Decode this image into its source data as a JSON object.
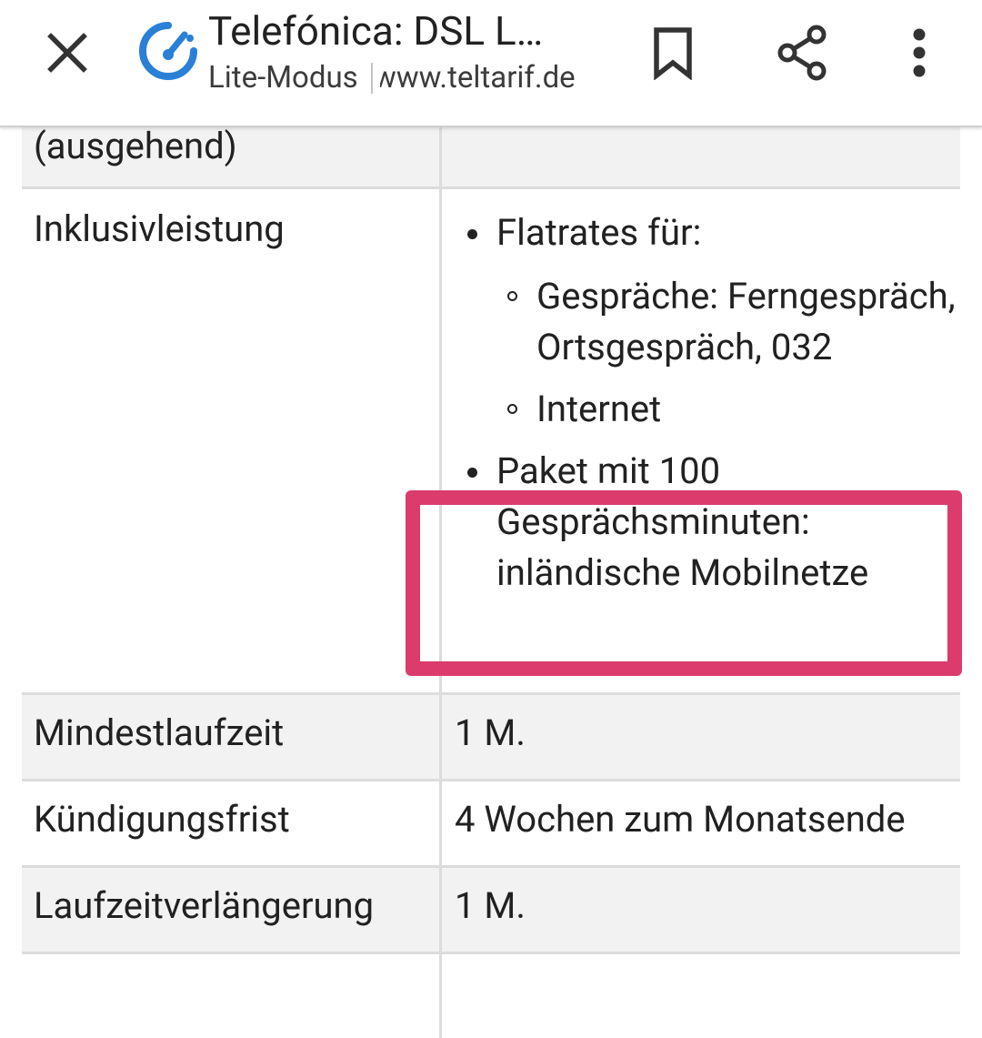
{
  "toolbar": {
    "title": "Telefónica: DSL L…",
    "mode": "Lite-Modus",
    "domain": "www.teltarif.de",
    "icons": {
      "close": "close-icon",
      "site": "speedometer-icon",
      "bookmark": "bookmark-icon",
      "share": "share-icon",
      "more": "more-vert-icon"
    }
  },
  "table": {
    "partial_row_label": "(ausgehend)",
    "inklusiv": {
      "label": "Inklusivleistung",
      "flatrates_label": "Flatrates für:",
      "flatrate_items": [
        "Gespräche: Ferngespräch, Ortsgespräch, 032",
        "Internet"
      ],
      "paket_label": "Paket mit 100 Gesprächsminuten: inländische Mobilnetze"
    },
    "rows": [
      {
        "label": "Mindestlaufzeit",
        "value": "1 M."
      },
      {
        "label": "Kündigungsfrist",
        "value": "4 Wochen zum Monatsende"
      },
      {
        "label": "Laufzeitverlängerung",
        "value": "1 M."
      }
    ]
  },
  "colors": {
    "highlight": "#dc3b6e",
    "logo_blue": "#2a7fd6",
    "row_gray": "#f2f2f2",
    "grid": "#dcdcdc"
  }
}
